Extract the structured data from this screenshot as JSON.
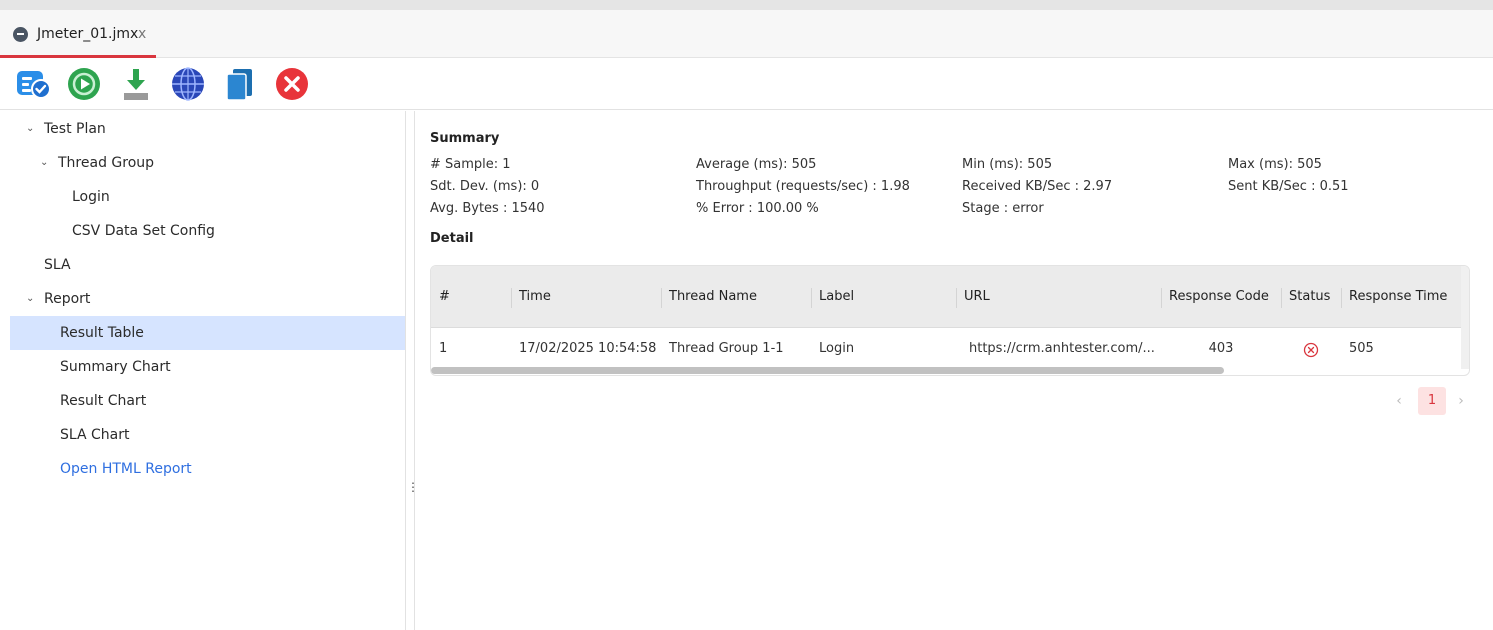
{
  "tab": {
    "title": "Jmeter_01.jmx",
    "close": "x",
    "icon": "jmeter-file-icon"
  },
  "toolbar": {
    "buttons": [
      "edit-check-icon",
      "run-icon",
      "download-icon",
      "globe-icon",
      "copy-icon",
      "stop-icon"
    ]
  },
  "sidebar": {
    "items": [
      {
        "label": "Test Plan",
        "expanded": true
      },
      {
        "label": "Thread Group",
        "expanded": true
      },
      {
        "label": "Login"
      },
      {
        "label": "CSV Data Set Config"
      },
      {
        "label": "SLA"
      },
      {
        "label": "Report",
        "expanded": true
      },
      {
        "label": "Result Table",
        "selected": true
      },
      {
        "label": "Summary Chart"
      },
      {
        "label": "Result Chart"
      },
      {
        "label": "SLA Chart"
      },
      {
        "label": "Open HTML Report",
        "link": true
      }
    ]
  },
  "splitter": "⋮",
  "summary": {
    "title": "Summary",
    "stats": {
      "sample": "# Sample: 1",
      "average": "Average (ms): 505",
      "min": "Min (ms): 505",
      "max": "Max (ms): 505",
      "stddev": "Sdt. Dev. (ms): 0",
      "throughput": "Throughput (requests/sec) : 1.98",
      "received": "Received KB/Sec : 2.97",
      "sent": "Sent KB/Sec : 0.51",
      "avg_bytes": "Avg. Bytes : 1540",
      "error": "% Error : 100.00 %",
      "stage": "Stage : error"
    }
  },
  "detail": {
    "title": "Detail",
    "columns": [
      "#",
      "Time",
      "Thread Name",
      "Label",
      "URL",
      "Response Code",
      "Status",
      "Response Time"
    ],
    "rows": [
      {
        "num": "1",
        "time": "17/02/2025 10:54:58",
        "thread": "Thread Group 1-1",
        "label": "Login",
        "url": "https://crm.anhtester.com/...",
        "code": "403",
        "status": "error-circle-icon",
        "response_time": "505"
      }
    ]
  },
  "pagination": {
    "prev": "‹",
    "current": "1",
    "next": "›"
  },
  "colors": {
    "accent": "#d9363e",
    "selected": "#d6e4ff",
    "link": "#2f6fe0"
  }
}
